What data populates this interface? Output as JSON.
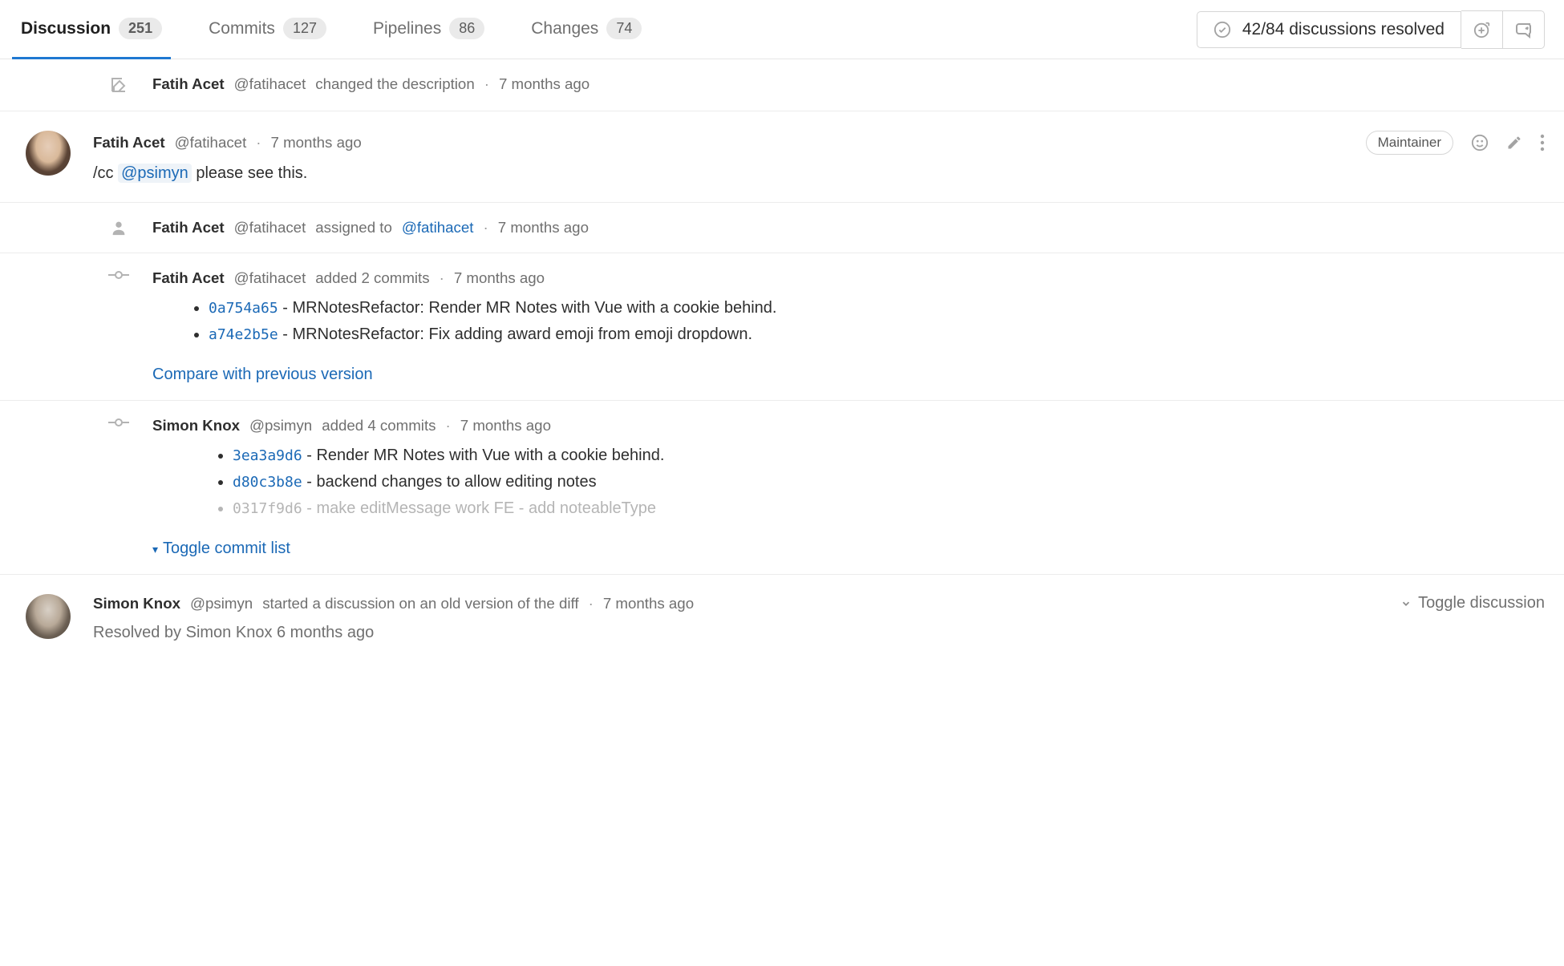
{
  "tabs": {
    "discussion": {
      "label": "Discussion",
      "count": "251"
    },
    "commits": {
      "label": "Commits",
      "count": "127"
    },
    "pipelines": {
      "label": "Pipelines",
      "count": "86"
    },
    "changes": {
      "label": "Changes",
      "count": "74"
    }
  },
  "resolved": {
    "text": "42/84 discussions resolved"
  },
  "ev0": {
    "author": "Fatih Acet",
    "handle": "@fatihacet",
    "action": "changed the description",
    "time": "7 months ago"
  },
  "note1": {
    "author": "Fatih Acet",
    "handle": "@fatihacet",
    "time": "7 months ago",
    "content_prefix": "/cc ",
    "mention": "@psimyn",
    "content_suffix": " please see this.",
    "badge": "Maintainer"
  },
  "ev2": {
    "author": "Fatih Acet",
    "handle": "@fatihacet",
    "action_pre": "assigned to ",
    "assignee": "@fatihacet",
    "time": "7 months ago"
  },
  "ev3": {
    "author": "Fatih Acet",
    "handle": "@fatihacet",
    "action": "added 2 commits",
    "time": "7 months ago",
    "c0": {
      "sha": "0a754a65",
      "msg": " - MRNotesRefactor: Render MR Notes with Vue with a cookie behind."
    },
    "c1": {
      "sha": "a74e2b5e",
      "msg": " - MRNotesRefactor: Fix adding award emoji from emoji dropdown."
    },
    "compare": "Compare with previous version"
  },
  "ev4": {
    "author": "Simon Knox",
    "handle": "@psimyn",
    "action": "added 4 commits",
    "time": "7 months ago",
    "c0": {
      "sha": "3ea3a9d6",
      "msg": " - Render MR Notes with Vue with a cookie behind."
    },
    "c1": {
      "sha": "d80c3b8e",
      "msg": " - backend changes to allow editing notes"
    },
    "c2": {
      "sha": "0317f9d6",
      "msg": " - make editMessage work FE - add noteableType"
    },
    "toggle": "Toggle commit list"
  },
  "disc": {
    "author": "Simon Knox",
    "handle": "@psimyn",
    "action": "started a discussion on an old version of the diff",
    "time": "7 months ago",
    "toggle": "Toggle discussion",
    "resolved": "Resolved by Simon Knox 6 months ago"
  }
}
